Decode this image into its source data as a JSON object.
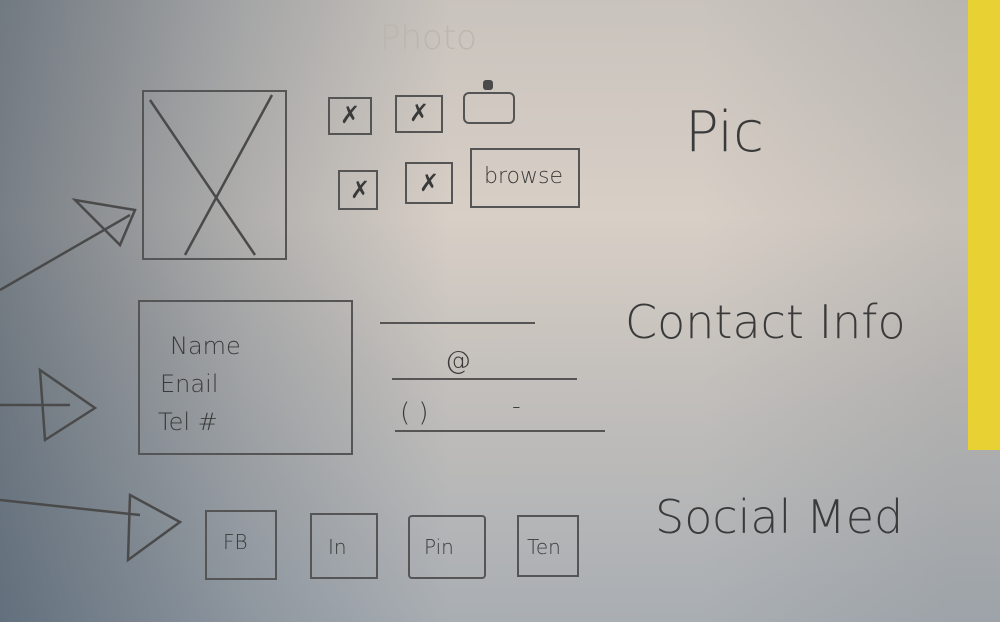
{
  "pic_section": {
    "faint_label": "Photo",
    "browse_label": "browse",
    "annotation": "Pic"
  },
  "contact_section": {
    "fields": [
      "Name",
      "Enail",
      "Tel #"
    ],
    "email_placeholder": "@",
    "phone_placeholder": "( )",
    "phone_dash": "-",
    "annotation": "Contact Info"
  },
  "social_section": {
    "buttons": [
      "FB",
      "In",
      "Pin",
      "Ten"
    ],
    "annotation": "Social Med"
  },
  "colors": {
    "paper": "#d8cfc6",
    "pencil": "#555555",
    "yellow_edge": "#e8d233"
  }
}
